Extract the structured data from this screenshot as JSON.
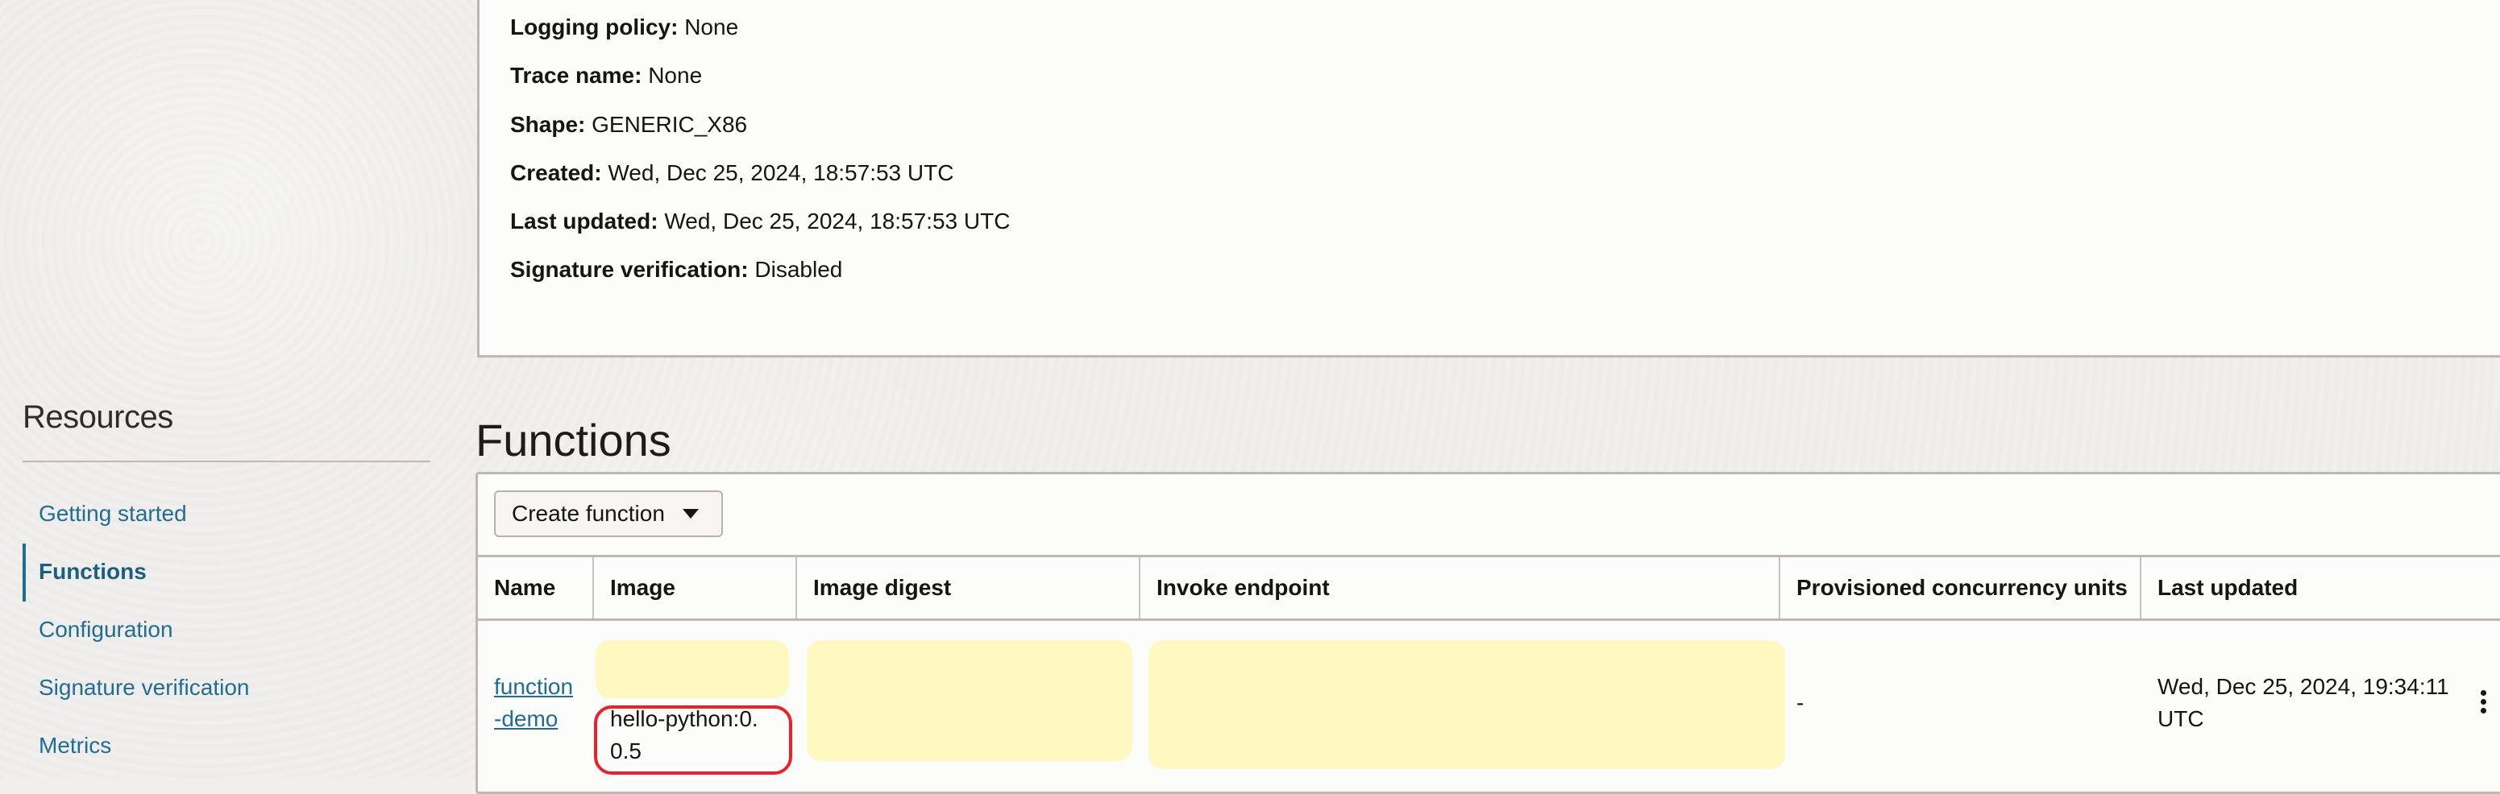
{
  "details": {
    "rows": [
      {
        "label": "Logging policy:",
        "value": "None"
      },
      {
        "label": "Trace name:",
        "value": "None"
      },
      {
        "label": "Shape:",
        "value": "GENERIC_X86"
      },
      {
        "label": "Created:",
        "value": "Wed, Dec 25, 2024, 18:57:53 UTC"
      },
      {
        "label": "Last updated:",
        "value": "Wed, Dec 25, 2024, 18:57:53 UTC"
      },
      {
        "label": "Signature verification:",
        "value": "Disabled"
      }
    ]
  },
  "sidebar": {
    "title": "Resources",
    "items": [
      {
        "label": "Getting started",
        "active": false
      },
      {
        "label": "Functions",
        "active": true
      },
      {
        "label": "Configuration",
        "active": false
      },
      {
        "label": "Signature verification",
        "active": false
      },
      {
        "label": "Metrics",
        "active": false
      }
    ]
  },
  "functions": {
    "title": "Functions",
    "create_button": "Create function",
    "columns": [
      "Name",
      "Image",
      "Image digest",
      "Invoke endpoint",
      "Provisioned concurrency units",
      "Last updated"
    ],
    "rows": [
      {
        "name_line1": "function",
        "name_line2": "-demo",
        "image_line1": "hello-python:0.",
        "image_line2": "0.5",
        "image_digest": "",
        "invoke_endpoint": "",
        "provisioned_concurrency": "-",
        "last_updated_line1": "Wed, Dec 25, 2024, 19:34:11",
        "last_updated_line2": "UTC"
      }
    ]
  },
  "colors": {
    "link": "#1f6d91",
    "redaction": "#fdf9c0",
    "annotation": "#e8212b"
  }
}
